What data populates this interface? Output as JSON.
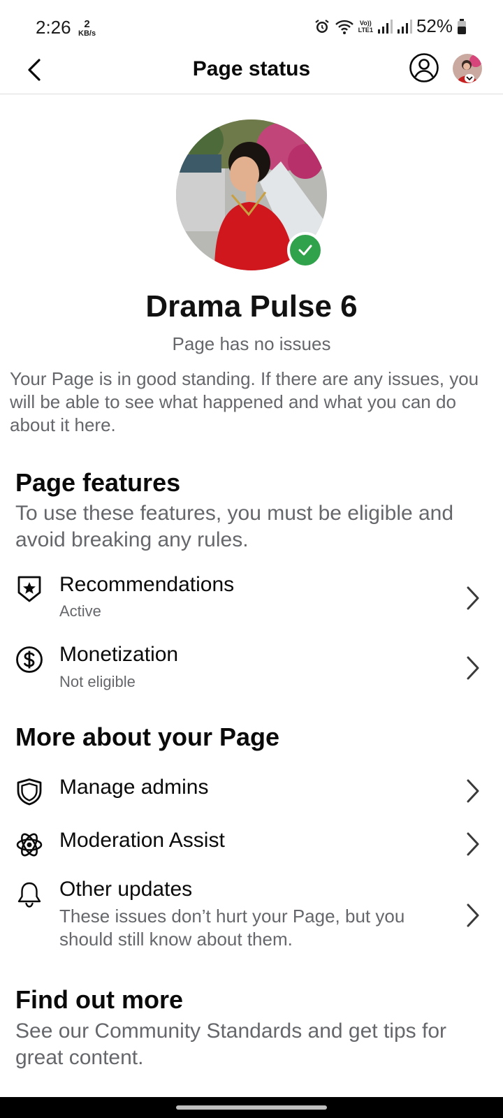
{
  "status_bar": {
    "time": "2:26",
    "speed_value": "2",
    "speed_unit": "KB/s",
    "network_label_top": "Vo))",
    "network_label_bottom": "LTE1",
    "battery": "52%"
  },
  "app_bar": {
    "title": "Page status",
    "icons": [
      "back-icon",
      "profile-icon",
      "avatar"
    ]
  },
  "page": {
    "name": "Drama Pulse 6",
    "state": "Page has no issues",
    "description": "Your Page is in good standing. If there are any issues, you will be able to see what happened and what you can do about it here."
  },
  "features": {
    "title": "Page features",
    "subtitle": "To use these features, you must be eligible and avoid breaking any rules.",
    "items": [
      {
        "label": "Recommendations",
        "status": "Active",
        "icon": "shield-star-icon"
      },
      {
        "label": "Monetization",
        "status": "Not eligible",
        "icon": "dollar-circle-icon"
      }
    ]
  },
  "more": {
    "title": "More about your Page",
    "items": [
      {
        "label": "Manage admins",
        "icon": "shield-icon"
      },
      {
        "label": "Moderation Assist",
        "icon": "atom-gear-icon"
      },
      {
        "label": "Other updates",
        "description": "These issues don’t hurt your Page, but you should still know about them.",
        "icon": "bell-icon"
      }
    ]
  },
  "find_out": {
    "title": "Find out more",
    "subtitle": "See our Community Standards and get tips for great content."
  },
  "colors": {
    "verified": "#31a24c",
    "secondary_text": "#65676b",
    "divider": "#dddddd"
  }
}
